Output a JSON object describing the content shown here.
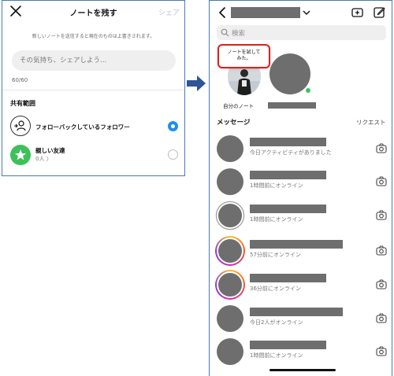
{
  "left_panel": {
    "title": "ノートを残す",
    "share_label": "シェア",
    "description": "新しいノートを送信すると現在のものは上書きされます。",
    "input_placeholder": "その気持ち、シェアしよう...",
    "char_count": "60/60",
    "section_title": "共有範囲",
    "options": [
      {
        "label": "フォローバックしているフォロワー",
        "sublabel": "",
        "selected": true,
        "icon": "follow-back-person-icon"
      },
      {
        "label": "親しい友達",
        "sublabel": "0人 〉",
        "selected": false,
        "icon": "green-star-icon"
      }
    ],
    "icons": {
      "close": "close-icon"
    }
  },
  "right_panel": {
    "search_placeholder": "検索",
    "my_note": {
      "bubble_text_line1": "ノートを試して",
      "bubble_text_line2": "みた。",
      "label": "自分のノート"
    },
    "messages_title": "メッセージ",
    "requests_label": "リクエスト",
    "messages": [
      {
        "status": "今日アクティビティがありました",
        "ring": "none"
      },
      {
        "status": "1時間前にオンライン",
        "ring": "none"
      },
      {
        "status": "1時間前にオンライン",
        "ring": "grey"
      },
      {
        "status": "57分前にオンライン",
        "ring": "story"
      },
      {
        "status": "36分前にオンライン",
        "ring": "story"
      },
      {
        "status": "今日2人がオンライン",
        "ring": "none"
      },
      {
        "status": "1時間前にオンライン",
        "ring": "none"
      }
    ],
    "icons": {
      "back": "back-chevron-icon",
      "video": "video-call-icon",
      "edit": "new-message-icon",
      "search": "search-icon",
      "camera": "camera-icon"
    },
    "colors": {
      "online": "#3ec05a",
      "highlight": "#e0201a",
      "accent": "#1e8ff0"
    }
  }
}
